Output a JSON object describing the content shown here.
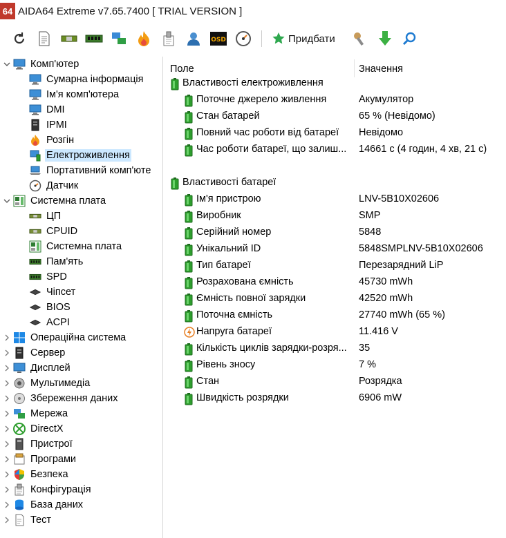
{
  "window": {
    "logo_text": "64",
    "title": "AIDA64 Extreme v7.65.7400  [ TRIAL VERSION ]"
  },
  "toolbar": {
    "icons": [
      "refresh-icon",
      "report-icon",
      "cpu-icon",
      "memory-icon",
      "network-icon",
      "flame-icon",
      "tools-icon",
      "user-icon",
      "osd-icon",
      "gauge-icon"
    ],
    "osd_text": "OSD",
    "buy_label": "Придбати",
    "extra_icons": [
      "wrench-icon",
      "download-arrow-icon",
      "search-icon"
    ]
  },
  "tree": [
    {
      "label": "Комп'ютер",
      "level": 0,
      "toggle": "expanded",
      "icon": "computer-icon"
    },
    {
      "label": "Сумарна інформація",
      "level": 1,
      "toggle": "",
      "icon": "computer-icon"
    },
    {
      "label": "Ім'я комп'ютера",
      "level": 1,
      "toggle": "",
      "icon": "computer-icon"
    },
    {
      "label": "DMI",
      "level": 1,
      "toggle": "",
      "icon": "computer-icon"
    },
    {
      "label": "IPMI",
      "level": 1,
      "toggle": "",
      "icon": "server-icon"
    },
    {
      "label": "Розгін",
      "level": 1,
      "toggle": "",
      "icon": "flame-icon"
    },
    {
      "label": "Електроживлення",
      "level": 1,
      "toggle": "",
      "icon": "power-icon",
      "selected": true
    },
    {
      "label": "Портативний комп'юте",
      "level": 1,
      "toggle": "",
      "icon": "laptop-icon"
    },
    {
      "label": "Датчик",
      "level": 1,
      "toggle": "",
      "icon": "gauge-icon"
    },
    {
      "label": "Системна плата",
      "level": 0,
      "toggle": "expanded",
      "icon": "motherboard-icon"
    },
    {
      "label": "ЦП",
      "level": 1,
      "toggle": "",
      "icon": "cpu-icon"
    },
    {
      "label": "CPUID",
      "level": 1,
      "toggle": "",
      "icon": "cpu-icon"
    },
    {
      "label": "Системна плата",
      "level": 1,
      "toggle": "",
      "icon": "motherboard-icon"
    },
    {
      "label": "Пам'ять",
      "level": 1,
      "toggle": "",
      "icon": "memory-icon"
    },
    {
      "label": "SPD",
      "level": 1,
      "toggle": "",
      "icon": "memory-icon"
    },
    {
      "label": "Чіпсет",
      "level": 1,
      "toggle": "",
      "icon": "chip-icon"
    },
    {
      "label": "BIOS",
      "level": 1,
      "toggle": "",
      "icon": "chip-icon"
    },
    {
      "label": "ACPI",
      "level": 1,
      "toggle": "",
      "icon": "chip-icon"
    },
    {
      "label": "Операційна система",
      "level": 0,
      "toggle": "collapsed",
      "icon": "windows-icon"
    },
    {
      "label": "Сервер",
      "level": 0,
      "toggle": "collapsed",
      "icon": "server-icon"
    },
    {
      "label": "Дисплей",
      "level": 0,
      "toggle": "collapsed",
      "icon": "monitor-icon"
    },
    {
      "label": "Мультимедіа",
      "level": 0,
      "toggle": "collapsed",
      "icon": "speaker-icon"
    },
    {
      "label": "Збереження даних",
      "level": 0,
      "toggle": "collapsed",
      "icon": "disk-icon"
    },
    {
      "label": "Мережа",
      "level": 0,
      "toggle": "collapsed",
      "icon": "network-icon"
    },
    {
      "label": "DirectX",
      "level": 0,
      "toggle": "collapsed",
      "icon": "xbox-icon"
    },
    {
      "label": "Пристрої",
      "level": 0,
      "toggle": "collapsed",
      "icon": "devices-icon"
    },
    {
      "label": "Програми",
      "level": 0,
      "toggle": "collapsed",
      "icon": "programs-icon"
    },
    {
      "label": "Безпека",
      "level": 0,
      "toggle": "collapsed",
      "icon": "shield-icon"
    },
    {
      "label": "Конфігурація",
      "level": 0,
      "toggle": "collapsed",
      "icon": "config-icon"
    },
    {
      "label": "База даних",
      "level": 0,
      "toggle": "collapsed",
      "icon": "database-icon"
    },
    {
      "label": "Тест",
      "level": 0,
      "toggle": "collapsed",
      "icon": "test-icon"
    }
  ],
  "detail": {
    "col_field": "Поле",
    "col_value": "Значення",
    "rows": [
      {
        "kind": "group",
        "field": "Властивості електроживлення",
        "value": "",
        "icon": "battery-icon"
      },
      {
        "kind": "item",
        "field": "Поточне джерело живлення",
        "value": "Акумулятор",
        "icon": "battery-icon"
      },
      {
        "kind": "item",
        "field": "Стан батарей",
        "value": "65 % (Невідомо)",
        "icon": "battery-icon"
      },
      {
        "kind": "item",
        "field": "Повний час роботи від батареї",
        "value": "Невідомо",
        "icon": "battery-icon"
      },
      {
        "kind": "item",
        "field": "Час роботи батареї, що залиш...",
        "value": "14661 с (4 годин, 4 хв, 21 с)",
        "icon": "battery-icon"
      },
      {
        "kind": "blank",
        "field": "",
        "value": "",
        "icon": ""
      },
      {
        "kind": "group",
        "field": "Властивості батареї",
        "value": "",
        "icon": "battery-icon"
      },
      {
        "kind": "item",
        "field": "Ім'я пристрою",
        "value": "LNV-5B10X02606",
        "icon": "battery-icon"
      },
      {
        "kind": "item",
        "field": "Виробник",
        "value": "SMP",
        "icon": "battery-icon"
      },
      {
        "kind": "item",
        "field": "Серійний номер",
        "value": "5848",
        "icon": "battery-icon"
      },
      {
        "kind": "item",
        "field": "Унікальний ID",
        "value": "5848SMPLNV-5B10X02606",
        "icon": "battery-icon"
      },
      {
        "kind": "item",
        "field": "Тип батареї",
        "value": "Перезарядний LiP",
        "icon": "battery-icon"
      },
      {
        "kind": "item",
        "field": "Розрахована ємність",
        "value": "45730 mWh",
        "icon": "battery-icon"
      },
      {
        "kind": "item",
        "field": "Ємність повної зарядки",
        "value": "42520 mWh",
        "icon": "battery-icon"
      },
      {
        "kind": "item",
        "field": "Поточна ємність",
        "value": "27740 mWh  (65 %)",
        "icon": "battery-icon"
      },
      {
        "kind": "item",
        "field": "Напруга батареї",
        "value": "11.416 V",
        "icon": "voltage-icon"
      },
      {
        "kind": "item",
        "field": "Кількість циклів зарядки-розря...",
        "value": "35",
        "icon": "battery-icon"
      },
      {
        "kind": "item",
        "field": "Рівень зносу",
        "value": "7 %",
        "icon": "battery-icon"
      },
      {
        "kind": "item",
        "field": "Стан",
        "value": "Розрядка",
        "icon": "battery-icon"
      },
      {
        "kind": "item",
        "field": "Швидкість розрядки",
        "value": "6906 mW",
        "icon": "battery-icon"
      }
    ]
  },
  "colors": {
    "selection": "#cce8ff",
    "battery": "#2e9e2e",
    "logo": "#c0392b",
    "buy_icon": "#2fa84f"
  }
}
